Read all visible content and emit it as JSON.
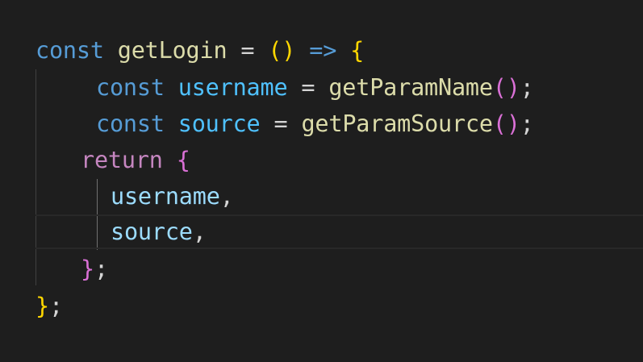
{
  "code": {
    "line1": {
      "kw": "const",
      "fn": "getLogin",
      "eq": "=",
      "paren": "()",
      "arrow": "=>",
      "brace": "{"
    },
    "line2": {
      "kw": "const",
      "var": "username",
      "eq": "=",
      "fn": "getParamName",
      "paren": "()",
      "semi": ";"
    },
    "line3": {
      "kw": "const",
      "var": "source",
      "eq": "=",
      "fn": "getParamSource",
      "paren": "()",
      "semi": ";"
    },
    "line4": {
      "ret": "return",
      "brace": "{"
    },
    "line5": {
      "var": "username",
      "comma": ","
    },
    "line6": {
      "var": "source",
      "comma": ","
    },
    "line7": {
      "brace": "}",
      "semi": ";"
    },
    "line8": {
      "brace": "}",
      "semi": ";"
    }
  },
  "colors": {
    "background": "#1e1e1e",
    "keyword": "#569cd6",
    "control": "#c586c0",
    "function": "#dcdcaa",
    "variable": "#9cdcfe",
    "constant": "#4fc1ff",
    "bracket_1": "#ffd700",
    "bracket_2": "#da70d6",
    "bracket_3": "#179fff"
  }
}
